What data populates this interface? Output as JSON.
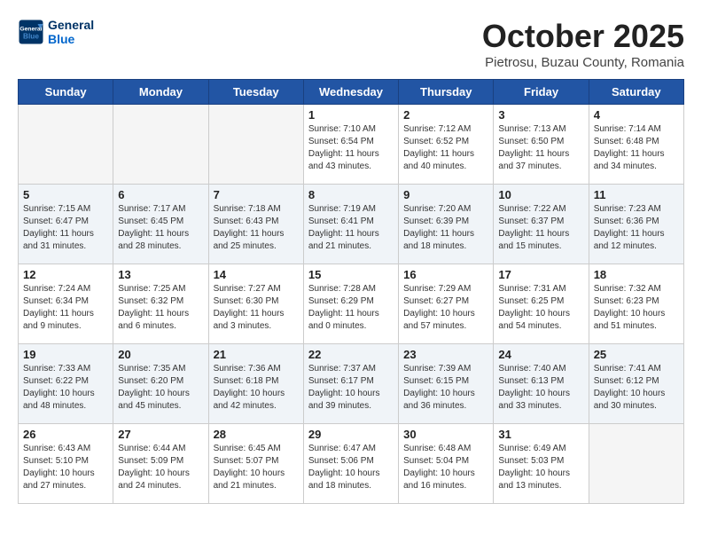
{
  "header": {
    "logo_line1": "General",
    "logo_line2": "Blue",
    "month": "October 2025",
    "location": "Pietrosu, Buzau County, Romania"
  },
  "weekdays": [
    "Sunday",
    "Monday",
    "Tuesday",
    "Wednesday",
    "Thursday",
    "Friday",
    "Saturday"
  ],
  "weeks": [
    [
      {
        "date": "",
        "text": ""
      },
      {
        "date": "",
        "text": ""
      },
      {
        "date": "",
        "text": ""
      },
      {
        "date": "1",
        "text": "Sunrise: 7:10 AM\nSunset: 6:54 PM\nDaylight: 11 hours and 43 minutes."
      },
      {
        "date": "2",
        "text": "Sunrise: 7:12 AM\nSunset: 6:52 PM\nDaylight: 11 hours and 40 minutes."
      },
      {
        "date": "3",
        "text": "Sunrise: 7:13 AM\nSunset: 6:50 PM\nDaylight: 11 hours and 37 minutes."
      },
      {
        "date": "4",
        "text": "Sunrise: 7:14 AM\nSunset: 6:48 PM\nDaylight: 11 hours and 34 minutes."
      }
    ],
    [
      {
        "date": "5",
        "text": "Sunrise: 7:15 AM\nSunset: 6:47 PM\nDaylight: 11 hours and 31 minutes."
      },
      {
        "date": "6",
        "text": "Sunrise: 7:17 AM\nSunset: 6:45 PM\nDaylight: 11 hours and 28 minutes."
      },
      {
        "date": "7",
        "text": "Sunrise: 7:18 AM\nSunset: 6:43 PM\nDaylight: 11 hours and 25 minutes."
      },
      {
        "date": "8",
        "text": "Sunrise: 7:19 AM\nSunset: 6:41 PM\nDaylight: 11 hours and 21 minutes."
      },
      {
        "date": "9",
        "text": "Sunrise: 7:20 AM\nSunset: 6:39 PM\nDaylight: 11 hours and 18 minutes."
      },
      {
        "date": "10",
        "text": "Sunrise: 7:22 AM\nSunset: 6:37 PM\nDaylight: 11 hours and 15 minutes."
      },
      {
        "date": "11",
        "text": "Sunrise: 7:23 AM\nSunset: 6:36 PM\nDaylight: 11 hours and 12 minutes."
      }
    ],
    [
      {
        "date": "12",
        "text": "Sunrise: 7:24 AM\nSunset: 6:34 PM\nDaylight: 11 hours and 9 minutes."
      },
      {
        "date": "13",
        "text": "Sunrise: 7:25 AM\nSunset: 6:32 PM\nDaylight: 11 hours and 6 minutes."
      },
      {
        "date": "14",
        "text": "Sunrise: 7:27 AM\nSunset: 6:30 PM\nDaylight: 11 hours and 3 minutes."
      },
      {
        "date": "15",
        "text": "Sunrise: 7:28 AM\nSunset: 6:29 PM\nDaylight: 11 hours and 0 minutes."
      },
      {
        "date": "16",
        "text": "Sunrise: 7:29 AM\nSunset: 6:27 PM\nDaylight: 10 hours and 57 minutes."
      },
      {
        "date": "17",
        "text": "Sunrise: 7:31 AM\nSunset: 6:25 PM\nDaylight: 10 hours and 54 minutes."
      },
      {
        "date": "18",
        "text": "Sunrise: 7:32 AM\nSunset: 6:23 PM\nDaylight: 10 hours and 51 minutes."
      }
    ],
    [
      {
        "date": "19",
        "text": "Sunrise: 7:33 AM\nSunset: 6:22 PM\nDaylight: 10 hours and 48 minutes."
      },
      {
        "date": "20",
        "text": "Sunrise: 7:35 AM\nSunset: 6:20 PM\nDaylight: 10 hours and 45 minutes."
      },
      {
        "date": "21",
        "text": "Sunrise: 7:36 AM\nSunset: 6:18 PM\nDaylight: 10 hours and 42 minutes."
      },
      {
        "date": "22",
        "text": "Sunrise: 7:37 AM\nSunset: 6:17 PM\nDaylight: 10 hours and 39 minutes."
      },
      {
        "date": "23",
        "text": "Sunrise: 7:39 AM\nSunset: 6:15 PM\nDaylight: 10 hours and 36 minutes."
      },
      {
        "date": "24",
        "text": "Sunrise: 7:40 AM\nSunset: 6:13 PM\nDaylight: 10 hours and 33 minutes."
      },
      {
        "date": "25",
        "text": "Sunrise: 7:41 AM\nSunset: 6:12 PM\nDaylight: 10 hours and 30 minutes."
      }
    ],
    [
      {
        "date": "26",
        "text": "Sunrise: 6:43 AM\nSunset: 5:10 PM\nDaylight: 10 hours and 27 minutes."
      },
      {
        "date": "27",
        "text": "Sunrise: 6:44 AM\nSunset: 5:09 PM\nDaylight: 10 hours and 24 minutes."
      },
      {
        "date": "28",
        "text": "Sunrise: 6:45 AM\nSunset: 5:07 PM\nDaylight: 10 hours and 21 minutes."
      },
      {
        "date": "29",
        "text": "Sunrise: 6:47 AM\nSunset: 5:06 PM\nDaylight: 10 hours and 18 minutes."
      },
      {
        "date": "30",
        "text": "Sunrise: 6:48 AM\nSunset: 5:04 PM\nDaylight: 10 hours and 16 minutes."
      },
      {
        "date": "31",
        "text": "Sunrise: 6:49 AM\nSunset: 5:03 PM\nDaylight: 10 hours and 13 minutes."
      },
      {
        "date": "",
        "text": ""
      }
    ]
  ]
}
